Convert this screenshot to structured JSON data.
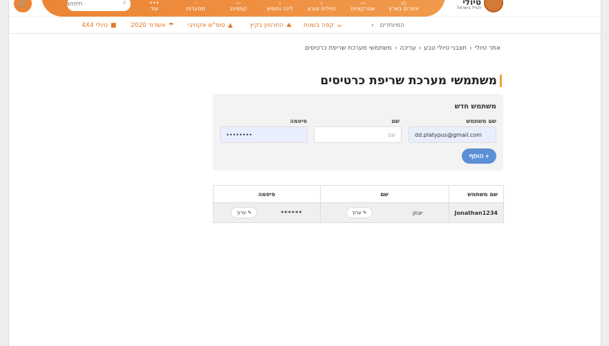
{
  "header": {
    "logo_text": "טיולי",
    "logo_sub": "לטייל בישראל",
    "search_placeholder": "חיפוש",
    "nav": [
      {
        "label": "אזורים בארץ",
        "icon": "map-icon"
      },
      {
        "label": "אטרקציות",
        "icon": "star-icon"
      },
      {
        "label": "טיולים וטבע",
        "icon": "tree-icon"
      },
      {
        "label": "לינה וחופש",
        "icon": "bed-icon"
      },
      {
        "label": "קמפינג",
        "icon": "tent-icon"
      },
      {
        "label": "מסעדות",
        "icon": "fork-icon"
      },
      {
        "label": "עוד",
        "icon": "dots-icon"
      }
    ]
  },
  "subnav": {
    "featured": "המיוחדים",
    "items": [
      {
        "label": "קפה בשטח",
        "icon": "cup-icon"
      },
      {
        "label": "החרמון בקיץ",
        "icon": "mountain-icon"
      },
      {
        "label": "סופ\"ש אקטיבי",
        "icon": "boot-icon"
      },
      {
        "label": "אשדוד 2020",
        "icon": "umbrella-icon"
      },
      {
        "label": "טיולי 4X4",
        "icon": "car-icon"
      }
    ]
  },
  "breadcrumb": [
    "אתר טיולי",
    "חצבני טיולי טבע",
    "עריכה",
    "משתמשי מערכת שריפת כרטיסים"
  ],
  "page_title": "משתמשי מערכת שריפת כרטיסים",
  "form": {
    "title": "משתמש חדש",
    "username_label": "שם משתמש",
    "username_value": "dd.platypus@gmail.com",
    "name_label": "שם",
    "name_placeholder": "שם",
    "password_label": "סיסמה",
    "password_value": "••••••••",
    "add_label": "+ הוסף"
  },
  "table": {
    "headers": [
      "שם משתמש",
      "שם",
      "סיסמה"
    ],
    "rows": [
      {
        "username": "Jonathan1234",
        "name": "יונתן",
        "password": "******",
        "edit_label": "✎ ערוך"
      }
    ]
  },
  "colors": {
    "accent": "#ec8434",
    "button": "#5b8fd6"
  }
}
